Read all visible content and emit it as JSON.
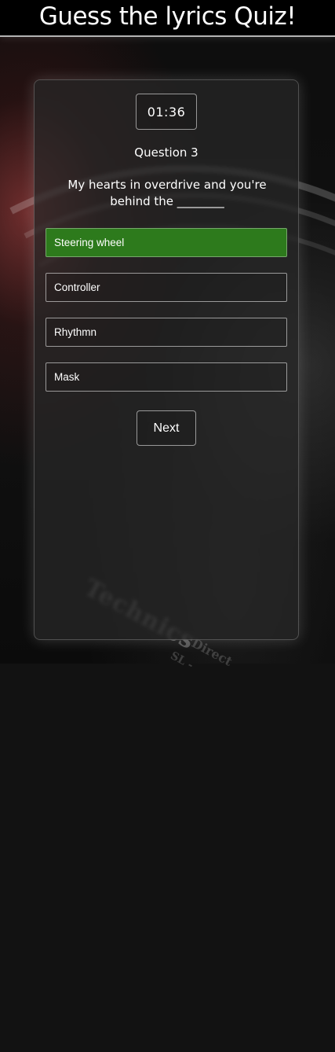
{
  "header": {
    "title": "Guess the lyrics Quiz!"
  },
  "quiz": {
    "timer": "01:36",
    "question_number": "Question 3",
    "question_text": "My hearts in overdrive and you're behind the ________",
    "answers": [
      {
        "label": "Steering wheel",
        "selected": true
      },
      {
        "label": "Controller",
        "selected": false
      },
      {
        "label": "Rhythmn",
        "selected": false
      },
      {
        "label": "Mask",
        "selected": false
      }
    ],
    "next_label": "Next"
  },
  "background": {
    "watermark_brand": "Technics",
    "watermark_direct": "Direct",
    "watermark_sl": "SL -"
  },
  "colors": {
    "selected_answer": "#2d7a1c",
    "header_bg": "#000000",
    "card_bg": "rgba(40,40,40,0.72)"
  }
}
